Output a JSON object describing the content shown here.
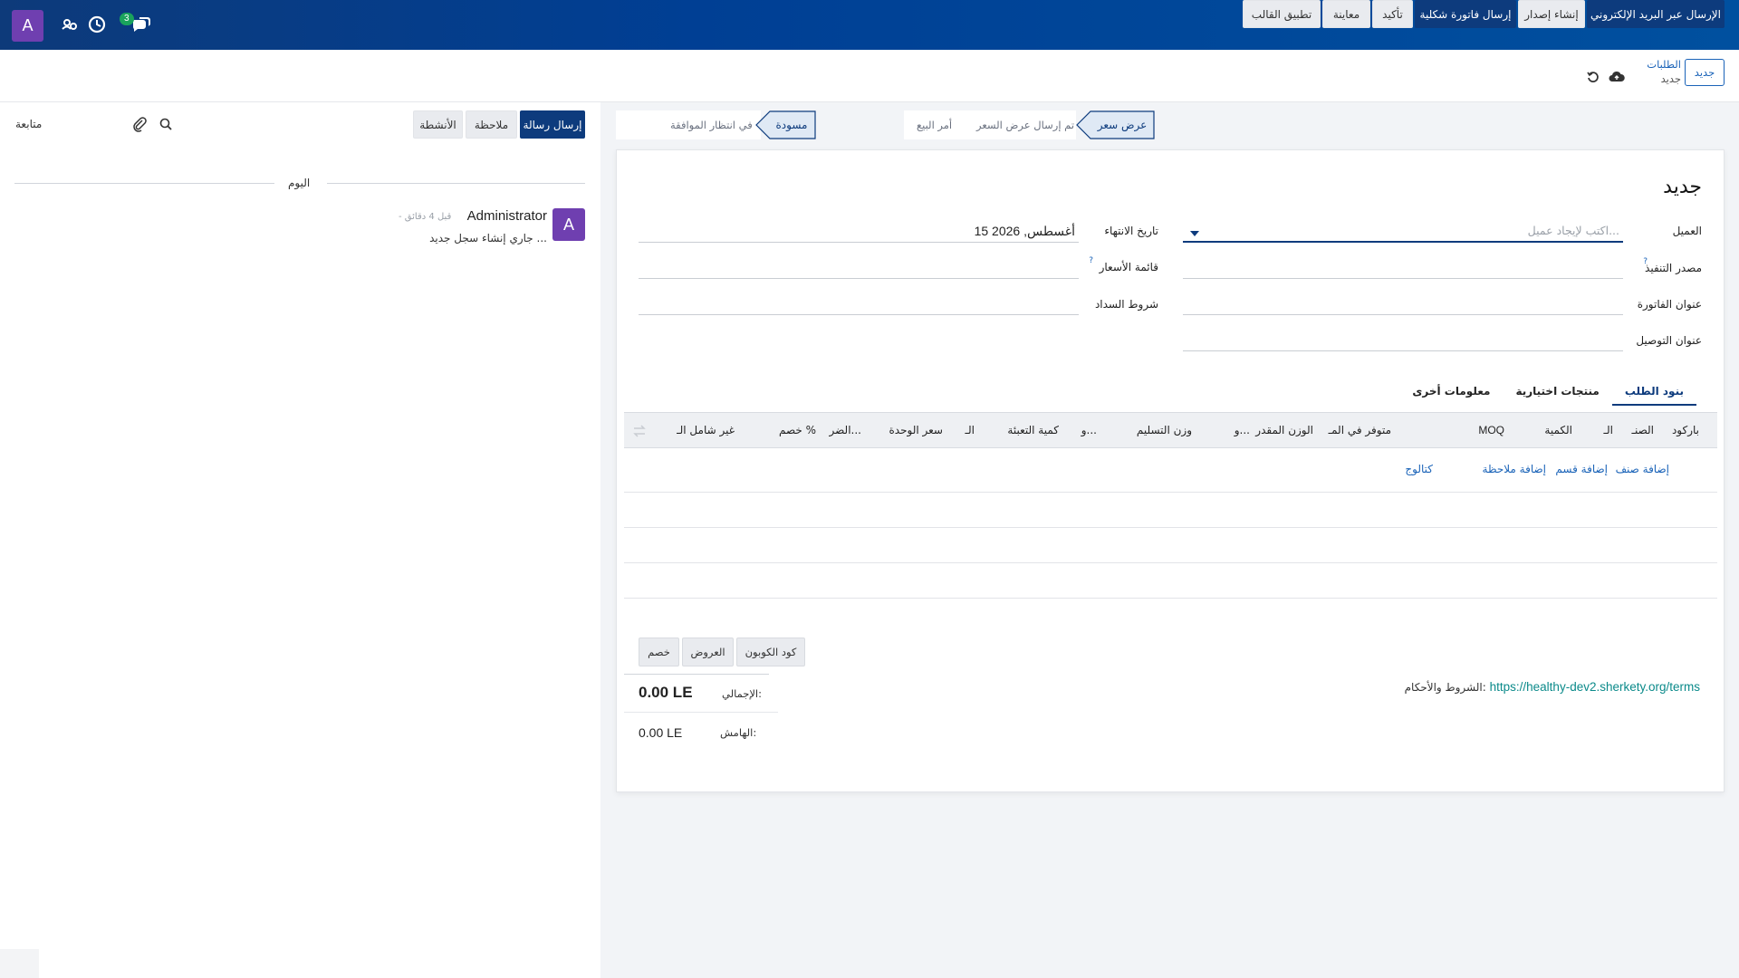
{
  "navbar": {
    "avatar_letter": "A",
    "badge_count": "3",
    "icons": [
      "people-gear-icon",
      "clock-icon",
      "chat-bubbles-icon"
    ]
  },
  "control_panel": {
    "breadcrumb_parent": "الطلبات",
    "breadcrumb_current": "جديد",
    "new_button": "جديد",
    "icons": [
      "cloud-upload-icon",
      "discard-icon"
    ]
  },
  "action_buttons": [
    "الإرسال عبر البريد الإلكتروني",
    "إنشاء إصدار",
    "إرسال فاتورة شكلية",
    "تأكيد",
    "معاينة",
    "تطبيق القالب"
  ],
  "status_stages": [
    "عرض سعر",
    "تم إرسال عرض السعر",
    "أمر البيع"
  ],
  "approval_stages": [
    "مسودة",
    "في انتظار الموافقة"
  ],
  "form": {
    "title": "جديد",
    "customer_label": "العميل",
    "customer_placeholder": "اكتب لإيجاد عميل...",
    "source_label": "مصدر التنفيذ",
    "invoice_address_label": "عنوان الفاتورة",
    "delivery_address_label": "عنوان التوصيل",
    "expiry_label": "تاريخ الانتهاء",
    "expiry_value": "15 أغسطس, 2026",
    "pricelist_label": "قائمة الأسعار",
    "payment_terms_label": "شروط السداد",
    "help_mark": "?"
  },
  "tabs": [
    "بنود الطلب",
    "منتجات اختيارية",
    "معلومات أخرى"
  ],
  "order_lines": {
    "columns": [
      "باركود",
      "الصنـ",
      "الـ",
      "الكمية",
      "MOQ",
      "متوفر في المـ",
      "الوزن المقدر",
      "و...",
      "وزن التسليم",
      "و...",
      "كمية التعبئة",
      "الـ",
      "سعر الوحدة",
      "الضر...",
      "خصم %",
      "غير شامل الـ"
    ],
    "add_links": [
      "إضافة صنف",
      "إضافة قسم",
      "إضافة ملاحظة",
      "كتالوج"
    ]
  },
  "promo_buttons": [
    "كود الكوبون",
    "العروض",
    "خصم"
  ],
  "terms": {
    "label": "الشروط والأحكام:",
    "url": "https://healthy-dev2.sherkety.org/terms"
  },
  "totals": {
    "total_label": "الإجمالي:",
    "total_value": "0.00 LE",
    "margin_label": "الهامش:",
    "margin_value": "0.00 LE"
  },
  "chatter": {
    "send_message": "إرسال رسالة",
    "log_note": "ملاحظة",
    "activities": "الأنشطة",
    "follow": "متابعة",
    "today": "اليوم",
    "author": "Administrator",
    "time": "- قبل 4 دقائق",
    "body": "جاري إنشاء سجل جديد ...",
    "avatar_letter": "A"
  },
  "colors": {
    "navbar": "#003f94",
    "primary": "#0d3b7d",
    "avatar": "#6f3fb0",
    "link": "#1a63b8",
    "terms_link": "#0b8a8a"
  }
}
